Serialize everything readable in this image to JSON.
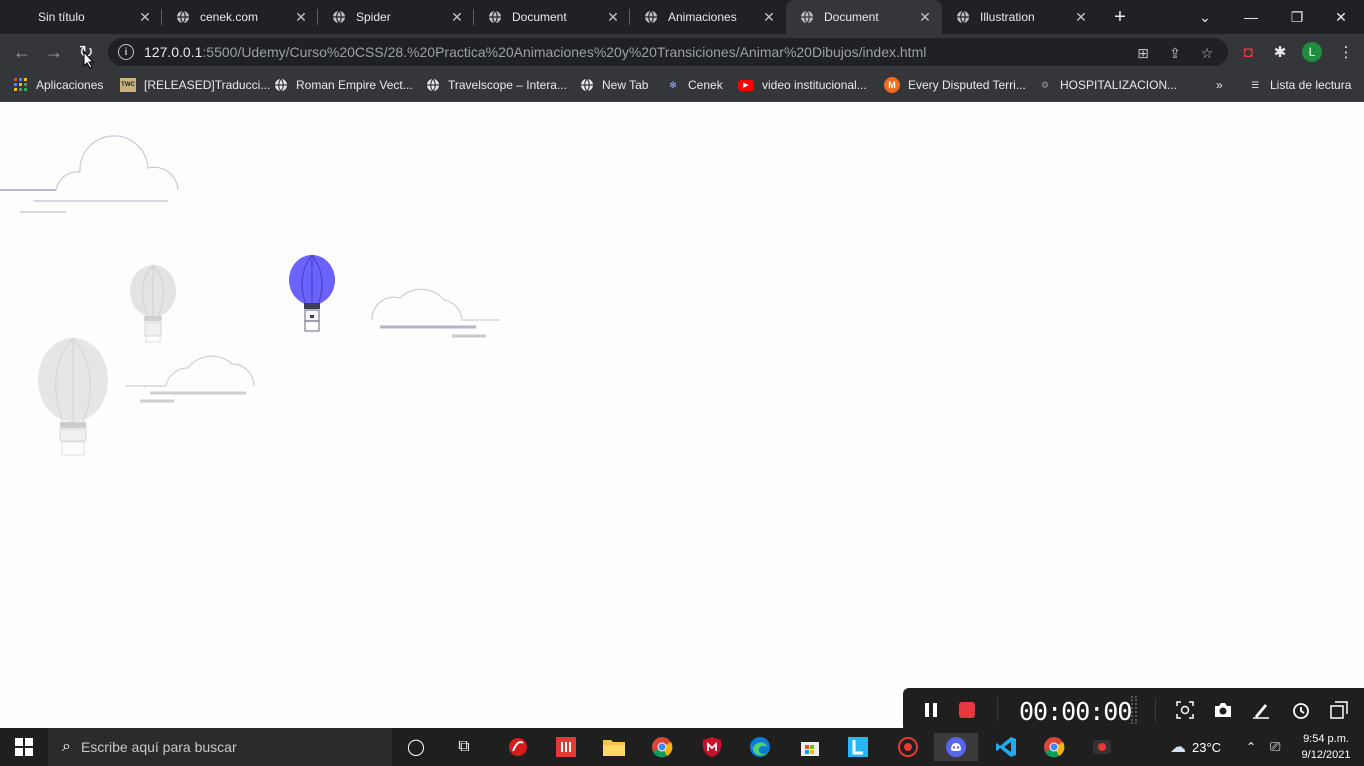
{
  "tabs": [
    {
      "label": "Sin título"
    },
    {
      "label": "cenek.com"
    },
    {
      "label": "Spider"
    },
    {
      "label": "Document"
    },
    {
      "label": "Animaciones"
    },
    {
      "label": "Document"
    },
    {
      "label": "Illustration"
    }
  ],
  "toolbar": {
    "url_host": "127.0.0.1",
    "url_path": ":5500/Udemy/Curso%20CSS/28.%20Practica%20Animaciones%20y%20Transiciones/Animar%20Dibujos/index.html",
    "avatar_letter": "L"
  },
  "bookmarks": [
    {
      "label": "Aplicaciones"
    },
    {
      "label": "[RELEASED]Traducci..."
    },
    {
      "label": "Roman Empire Vect..."
    },
    {
      "label": "Travelscope – Intera..."
    },
    {
      "label": "New Tab"
    },
    {
      "label": "Cenek"
    },
    {
      "label": "video institucional..."
    },
    {
      "label": "Every Disputed Terri..."
    },
    {
      "label": "HOSPITALIZACION..."
    },
    {
      "label": "Lista de lectura"
    }
  ],
  "bookmark_icons": {
    "twc": "TWC",
    "every_disputed": "M"
  },
  "recorder": {
    "timer": "00:00:00"
  },
  "taskbar": {
    "search_placeholder": "Escribe aquí para buscar",
    "temperature": "23°C",
    "time": "9:54 p.m.",
    "date": "9/12/2021"
  },
  "colors": {
    "balloon_accent": "#6c63ff",
    "chrome_dark": "#202124",
    "chrome_toolbar": "#35363a",
    "record_red": "#e8383d"
  }
}
